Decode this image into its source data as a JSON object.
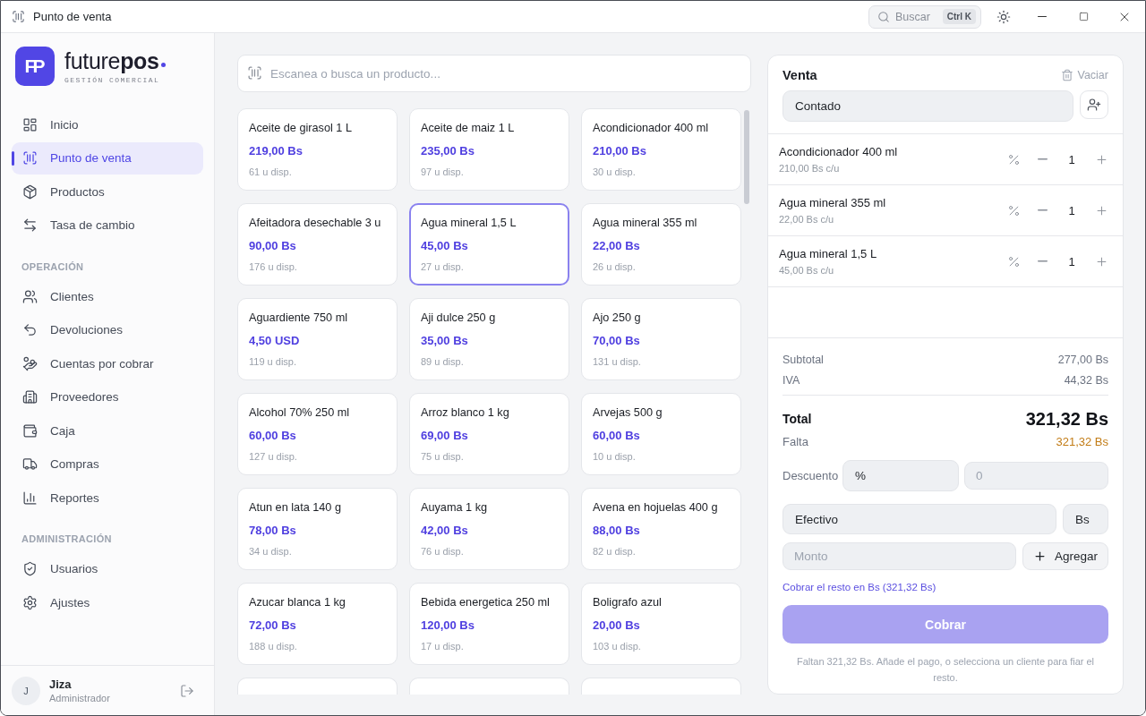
{
  "window": {
    "title": "Punto de venta",
    "search": {
      "label": "Buscar",
      "shortcut": "Ctrl K"
    }
  },
  "sidebar": {
    "brand": {
      "monogram": "FP",
      "wordmark": "future**pos**",
      "tagline": "GESTIÓN COMERCIAL"
    },
    "sections": [
      {
        "items": [
          {
            "label": "Inicio",
            "selected": false
          },
          {
            "label": "Punto de venta",
            "selected": true
          },
          {
            "label": "Productos",
            "selected": false
          },
          {
            "label": "Tasa de cambio",
            "selected": false
          }
        ]
      },
      {
        "heading": "OPERACIÓN",
        "items": [
          {
            "label": "Clientes",
            "selected": false
          },
          {
            "label": "Devoluciones",
            "selected": false
          },
          {
            "label": "Cuentas por cobrar",
            "selected": false
          },
          {
            "label": "Proveedores",
            "selected": false
          },
          {
            "label": "Caja",
            "selected": false
          },
          {
            "label": "Compras",
            "selected": false
          },
          {
            "label": "Reportes",
            "selected": false
          }
        ]
      },
      {
        "heading": "ADMINISTRACIÓN",
        "items": [
          {
            "label": "Usuarios",
            "selected": false
          },
          {
            "label": "Ajustes",
            "selected": false
          }
        ]
      }
    ],
    "user": {
      "initial": "J",
      "name": "Jiza",
      "role": "Administrador"
    }
  },
  "products": {
    "search": {
      "placeholder": "Escanea o busca un producto..."
    },
    "items": [
      {
        "name": "Aceite de girasol 1 L",
        "price": "219,00 Bs",
        "stock": "61 u disp.",
        "selected": false,
        "partial": false
      },
      {
        "name": "Aceite de maiz 1 L",
        "price": "235,00 Bs",
        "stock": "97 u disp.",
        "selected": false,
        "partial": false
      },
      {
        "name": "Acondicionador 400 ml",
        "price": "210,00 Bs",
        "stock": "30 u disp.",
        "selected": false,
        "partial": false
      },
      {
        "name": "Afeitadora desechable 3 u",
        "price": "90,00 Bs",
        "stock": "176 u disp.",
        "selected": false,
        "partial": false
      },
      {
        "name": "Agua mineral 1,5 L",
        "price": "45,00 Bs",
        "stock": "27 u disp.",
        "selected": true,
        "partial": false
      },
      {
        "name": "Agua mineral 355 ml",
        "price": "22,00 Bs",
        "stock": "26 u disp.",
        "selected": false,
        "partial": false
      },
      {
        "name": "Aguardiente 750 ml",
        "price": "4,50 USD",
        "stock": "119 u disp.",
        "selected": false,
        "partial": false
      },
      {
        "name": "Aji dulce 250 g",
        "price": "35,00 Bs",
        "stock": "89 u disp.",
        "selected": false,
        "partial": false
      },
      {
        "name": "Ajo 250 g",
        "price": "70,00 Bs",
        "stock": "131 u disp.",
        "selected": false,
        "partial": false
      },
      {
        "name": "Alcohol 70% 250 ml",
        "price": "60,00 Bs",
        "stock": "127 u disp.",
        "selected": false,
        "partial": false
      },
      {
        "name": "Arroz blanco 1 kg",
        "price": "69,00 Bs",
        "stock": "75 u disp.",
        "selected": false,
        "partial": false
      },
      {
        "name": "Arvejas 500 g",
        "price": "60,00 Bs",
        "stock": "10 u disp.",
        "selected": false,
        "partial": false
      },
      {
        "name": "Atun en lata 140 g",
        "price": "78,00 Bs",
        "stock": "34 u disp.",
        "selected": false,
        "partial": false
      },
      {
        "name": "Auyama 1 kg",
        "price": "42,00 Bs",
        "stock": "76 u disp.",
        "selected": false,
        "partial": false
      },
      {
        "name": "Avena en hojuelas 400 g",
        "price": "88,00 Bs",
        "stock": "82 u disp.",
        "selected": false,
        "partial": false
      },
      {
        "name": "Azucar blanca 1 kg",
        "price": "72,00 Bs",
        "stock": "188 u disp.",
        "selected": false,
        "partial": false
      },
      {
        "name": "Bebida energetica 250 ml",
        "price": "120,00 Bs",
        "stock": "17 u disp.",
        "selected": false,
        "partial": false
      },
      {
        "name": "Boligrafo azul",
        "price": "20,00 Bs",
        "stock": "103 u disp.",
        "selected": false,
        "partial": false
      },
      {
        "selected": false,
        "partial": true
      },
      {
        "selected": false,
        "partial": true
      },
      {
        "selected": false,
        "partial": true
      }
    ]
  },
  "sale": {
    "title": "Venta",
    "clear": "Vaciar",
    "customer": "Contado",
    "lines": [
      {
        "name": "Acondicionador 400 ml",
        "unit_price": "210,00 Bs c/u",
        "quantity": "1"
      },
      {
        "name": "Agua mineral 355 ml",
        "unit_price": "22,00 Bs c/u",
        "quantity": "1"
      },
      {
        "name": "Agua mineral 1,5 L",
        "unit_price": "45,00 Bs c/u",
        "quantity": "1"
      }
    ],
    "subtotal": {
      "label": "Subtotal",
      "value": "277,00 Bs"
    },
    "tax": {
      "label": "IVA",
      "value": "44,32 Bs"
    },
    "total": {
      "label": "Total",
      "value": "321,32 Bs"
    },
    "due": {
      "label": "Falta",
      "value": "321,32 Bs"
    },
    "discount": {
      "label": "Descuento",
      "type": "%",
      "placeholder": "0"
    },
    "payment": {
      "method": "Efectivo",
      "currency": "Bs",
      "amount_placeholder": "Monto",
      "add": "Agregar"
    },
    "pay_rest_link": "Cobrar el resto en Bs (321,32 Bs)",
    "submit": {
      "label": "Cobrar",
      "disabled": true
    },
    "hint": "Faltan 321,32 Bs. Añade el pago, o selecciona un cliente para fiar el resto."
  }
}
